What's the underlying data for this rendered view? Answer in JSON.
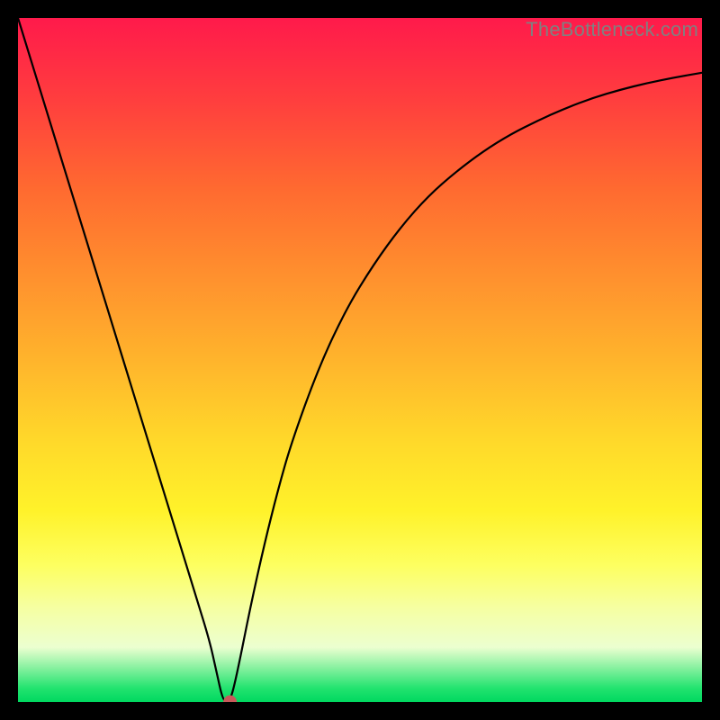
{
  "attribution": "TheBottleneck.com",
  "chart_data": {
    "type": "line",
    "title": "",
    "xlabel": "",
    "ylabel": "",
    "xlim": [
      0,
      100
    ],
    "ylim": [
      0,
      100
    ],
    "x": [
      0,
      2,
      4,
      6,
      8,
      10,
      12,
      14,
      16,
      18,
      20,
      22,
      24,
      26,
      28,
      29,
      30,
      31,
      32,
      34,
      36,
      38,
      40,
      44,
      48,
      52,
      56,
      60,
      64,
      68,
      72,
      76,
      80,
      84,
      88,
      92,
      96,
      100
    ],
    "y": [
      100,
      93.5,
      87,
      80.5,
      74,
      67.5,
      61,
      54.5,
      48,
      41.5,
      35,
      28.5,
      22,
      15.5,
      9,
      4.5,
      0,
      0,
      4,
      14,
      23,
      31,
      38,
      49,
      57.5,
      64,
      69.5,
      74,
      77.5,
      80.5,
      83,
      85,
      86.8,
      88.3,
      89.5,
      90.5,
      91.3,
      92
    ],
    "marker": {
      "x": 31,
      "y": 0,
      "color": "#c85a5a",
      "radius_px": 7
    }
  }
}
